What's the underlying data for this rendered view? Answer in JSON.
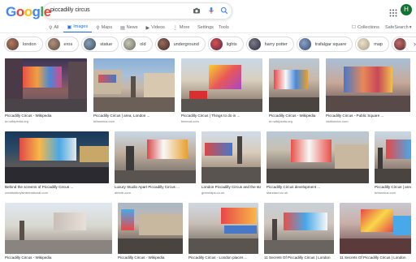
{
  "header": {
    "logo": "Google",
    "logo_letters": [
      {
        "ch": "G",
        "color": "#4285f4"
      },
      {
        "ch": "o",
        "color": "#ea4335"
      },
      {
        "ch": "o",
        "color": "#fbbc05"
      },
      {
        "ch": "g",
        "color": "#4285f4"
      },
      {
        "ch": "l",
        "color": "#34a853"
      },
      {
        "ch": "e",
        "color": "#ea4335"
      }
    ],
    "query": "piccadilly circus",
    "avatar_letter": "H"
  },
  "tabs": [
    {
      "label": "All",
      "icon": "search-icon"
    },
    {
      "label": "Images",
      "icon": "image-icon",
      "active": true
    },
    {
      "label": "Maps",
      "icon": "map-pin-icon"
    },
    {
      "label": "News",
      "icon": "news-icon"
    },
    {
      "label": "Videos",
      "icon": "video-icon"
    },
    {
      "label": "More",
      "icon": "more-icon"
    }
  ],
  "toolbar": {
    "settings": "Settings",
    "tools": "Tools",
    "collections": "Collections",
    "safesearch": "SafeSearch"
  },
  "chips": [
    {
      "label": "london",
      "color": "#7a5a4a"
    },
    {
      "label": "eros",
      "color": "#8a6a5a"
    },
    {
      "label": "statue",
      "color": "#5a6a7a"
    },
    {
      "label": "old",
      "color": "#8a8a7a"
    },
    {
      "label": "underground",
      "color": "#6a4a4a"
    },
    {
      "label": "lights",
      "color": "#a04040"
    },
    {
      "label": "harry potter",
      "color": "#4a4a5a"
    },
    {
      "label": "trafalgar square",
      "color": "#5a6a8a"
    },
    {
      "label": "map",
      "color": "#c8c0a8"
    },
    {
      "label": "phe",
      "color": "#9a4a4a"
    }
  ],
  "results": [
    {
      "caption": "Piccadilly Circus - Wikipedia",
      "source": "en.wikipedia.org"
    },
    {
      "caption": "Piccadilly Circus | area, London ...",
      "source": "britannica.com"
    },
    {
      "caption": "Piccadilly Circus | Things to do in ...",
      "source": "timeout.com"
    },
    {
      "caption": "Piccadilly Circus - Wikipedia",
      "source": "en.wikipedia.org"
    },
    {
      "caption": "Piccadilly Circus - Public Square ...",
      "source": "visitlondon.com"
    },
    {
      "caption": "Behind the screens of Piccadilly Circus ...",
      "source": "creativeboysinternational.com"
    },
    {
      "caption": "Luxury Studio Apart Piccadilly Circus ...",
      "source": "airbnb.com"
    },
    {
      "caption": "London Piccadilly Circus and the statue ...",
      "source": "greenlaps.co.uk"
    },
    {
      "caption": "Piccadilly Circus development ...",
      "source": "standard.co.uk"
    },
    {
      "caption": "Piccadilly Circus | area, London ...",
      "source": "britannica.com"
    },
    {
      "caption": "Piccadilly Circus - Wikipedia",
      "source": ""
    },
    {
      "caption": "Piccadilly Circus - Wikipedia",
      "source": ""
    },
    {
      "caption": "Piccadilly Circus - London places ...",
      "source": ""
    },
    {
      "caption": "11 Secrets Of Piccadilly Circus | London",
      "source": ""
    },
    {
      "caption": "11 Secrets Of Piccadilly Circus | London",
      "source": ""
    }
  ]
}
